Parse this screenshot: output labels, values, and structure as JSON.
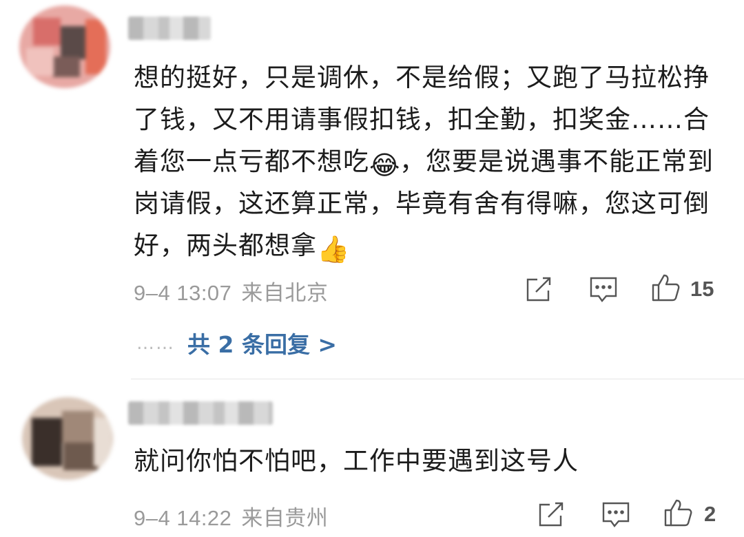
{
  "comments": [
    {
      "avatar_icon": "blurred-avatar",
      "username_hidden": true,
      "text_before_emoji": "想的挺好，只是调休，不是给假；又跑了马拉松挣了钱，又不用请事假扣钱，扣全勤，扣奖金……合着您一点亏都不想吃",
      "emoji_1": "😂",
      "text_middle": "，您要是说遇事不能正常到岗请假，这还算正常，毕竟有舍有得嘛，您这可倒好，两头都想拿",
      "emoji_2": "👍",
      "date": "9–4 13:07",
      "location": "来自北京",
      "likes": "15",
      "replies_label": "共 2 条回复 >",
      "replies_dots": "……"
    },
    {
      "avatar_icon": "blurred-avatar",
      "username_hidden": true,
      "text": "就问你怕不怕吧，工作中要遇到这号人",
      "date": "9–4 14:22",
      "location": "来自贵州",
      "likes": "2"
    }
  ],
  "icons": {
    "share": "share-icon",
    "comment": "comment-icon",
    "like": "thumbs-up-icon"
  },
  "colors": {
    "link": "#3a6ea5",
    "meta": "#9a9a9a"
  }
}
